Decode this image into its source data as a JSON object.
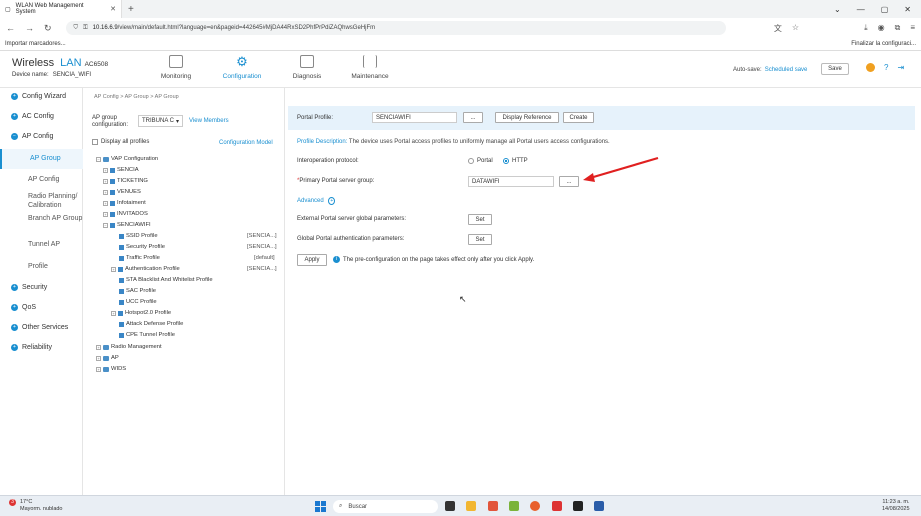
{
  "browser": {
    "tab_title": "WLAN Web Management System",
    "url_host": "10.16.6.9",
    "url_path": "/view/main/default.html?language=en&pageid=442645#MjDA44RxSD2PhfPrPdiZAQhwsGeHjFm",
    "bookmark_left": "Importar marcadores...",
    "bookmark_right": "Finalizar la configuraci..."
  },
  "header": {
    "brand_wireless": "Wireless",
    "brand_lan": "LAN",
    "model": "AC6508",
    "device_label": "Device name:",
    "device_name": "SENCIA_WIFI",
    "nav": [
      "Monitoring",
      "Configuration",
      "Diagnosis",
      "Maintenance"
    ],
    "autosave_label": "Auto-save:",
    "autosave_value": "Scheduled save",
    "save_label": "Save"
  },
  "sidebar": {
    "items": [
      "Config Wizard",
      "AC Config",
      "AP Config",
      "Security",
      "QoS",
      "Other Services",
      "Reliability"
    ],
    "sub_items": [
      "AP Group",
      "AP Config",
      "Radio Planning/ Calibration",
      "Branch AP Group",
      "Tunnel AP",
      "Profile"
    ]
  },
  "treepanel": {
    "breadcrumb": "AP Config > AP Group > AP Group",
    "group_label": "AP group configuration:",
    "group_value": "TRIBUNA C",
    "view_members": "View Members",
    "display_all": "Display all profiles",
    "config_model": "Configuration Model",
    "nodes": [
      "VAP Configuration",
      "SENCIA",
      "TICKETING",
      "VENUES",
      "Infotaiment",
      "INVITADOS",
      "SENCIAWIFI",
      "SSID Profile",
      "Security Profile",
      "Traffic Profile",
      "Authentication Profile",
      "STA Blacklist And Whitelist Profile",
      "SAC Profile",
      "UCC Profile",
      "Hotspot2.0 Profile",
      "Attack Defense Profile",
      "CPE Tunnel Profile",
      "Radio Management",
      "AP",
      "WIDS"
    ],
    "values": [
      "[SENCIA...]",
      "[SENCIA...]",
      "[default]",
      "[SENCIA...]"
    ]
  },
  "main": {
    "portal_profile_label": "Portal Profile:",
    "portal_profile_value": "SENCIAWIFI",
    "dots_label": "...",
    "display_reference": "Display Reference",
    "create_label": "Create",
    "desc_label": "Profile Description:",
    "desc_text": "The device uses Portal access profiles to uniformly manage all Portal users access configurations.",
    "interop_label": "Interoperation protocol:",
    "radio_portal": "Portal",
    "radio_http": "HTTP",
    "primary_label": "Primary Portal server group:",
    "primary_value": "DATAWIFI",
    "advanced": "Advanced",
    "external_label": "External Portal server global parameters:",
    "global_label": "Global Portal authentication parameters:",
    "set_label": "Set",
    "apply_label": "Apply",
    "info_text": "The pre-configuration on the page takes effect only after you click Apply."
  },
  "taskbar": {
    "temp": "17°C",
    "weather": "Mayorm. nublado",
    "badge": "3",
    "search": "Buscar",
    "time": "11:23 a. m.",
    "date": "14/08/2025"
  },
  "colors": {
    "accent": "#1a8fd0",
    "arrow": "#e02020"
  }
}
